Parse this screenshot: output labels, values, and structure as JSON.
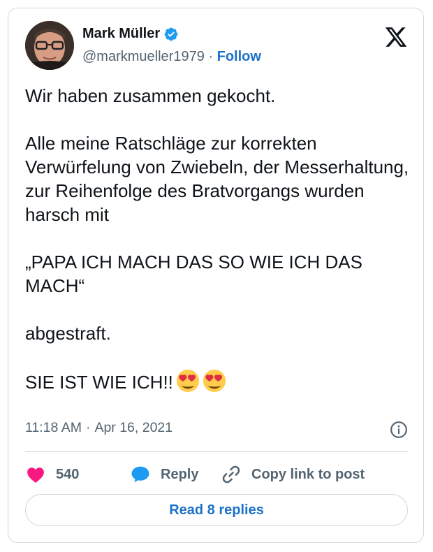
{
  "author": {
    "name": "Mark Müller",
    "handle": "@markmueller1979",
    "separator": "·",
    "follow_label": "Follow",
    "verified": true
  },
  "post": {
    "text": "Wir haben zusammen gekocht.\n\nAlle meine Ratschläge zur korrekten Verwürfelung von Zwiebeln, der Messerhaltung, zur Reihenfolge des Bratvorgangs wurden harsch mit\n\n„PAPA ICH MACH DAS SO WIE ICH DAS MACH“\n\nabgestraft.\n\nSIE IST WIE ICH!!",
    "emojis": [
      "heart-eyes-emoji",
      "heart-eyes-emoji"
    ],
    "time": "11:18 AM",
    "date_separator": "·",
    "date": "Apr 16, 2021"
  },
  "actions": {
    "like_count": "540",
    "reply_label": "Reply",
    "copy_link_label": "Copy link to post"
  },
  "read_replies_label": "Read 8 replies",
  "colors": {
    "accent": "#1d72c8",
    "heart": "#f91880",
    "reply_icon": "#1d9bf0",
    "muted": "#536471",
    "border": "#cfd9de"
  },
  "icons": {
    "platform": "x-logo-icon",
    "verified": "verified-badge-icon",
    "info": "info-icon",
    "like": "heart-icon",
    "reply": "speech-bubble-icon",
    "copy_link": "link-icon"
  }
}
